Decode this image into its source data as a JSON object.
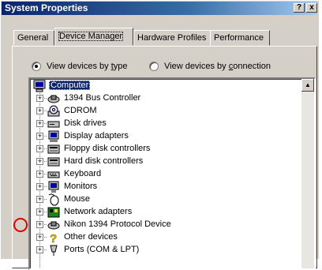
{
  "window": {
    "title": "System Properties",
    "help_label": "?",
    "close_label": "x"
  },
  "tabs": [
    {
      "label": "General"
    },
    {
      "label": "Device Manager"
    },
    {
      "label": "Hardware Profiles"
    },
    {
      "label": "Performance"
    }
  ],
  "view_options": {
    "by_type_prefix": "View devices by ",
    "by_type_accel": "t",
    "by_type_rest": "ype",
    "by_connection_prefix": "View devices by ",
    "by_connection_accel": "c",
    "by_connection_rest": "onnection",
    "selected": "by_type"
  },
  "tree": {
    "root": {
      "label": "Computer",
      "icon": "computer-icon"
    },
    "items": [
      {
        "label": "1394 Bus Controller",
        "icon": "bus-controller-icon"
      },
      {
        "label": "CDROM",
        "icon": "cdrom-icon"
      },
      {
        "label": "Disk drives",
        "icon": "disk-drive-icon"
      },
      {
        "label": "Display adapters",
        "icon": "display-adapter-icon"
      },
      {
        "label": "Floppy disk controllers",
        "icon": "floppy-controller-icon"
      },
      {
        "label": "Hard disk controllers",
        "icon": "hard-disk-controller-icon"
      },
      {
        "label": "Keyboard",
        "icon": "keyboard-icon"
      },
      {
        "label": "Monitors",
        "icon": "monitor-icon"
      },
      {
        "label": "Mouse",
        "icon": "mouse-icon"
      },
      {
        "label": "Network adapters",
        "icon": "network-adapter-icon"
      },
      {
        "label": "Nikon 1394 Protocol Device",
        "icon": "protocol-device-icon"
      },
      {
        "label": "Other devices",
        "icon": "question-mark-icon"
      },
      {
        "label": "Ports (COM & LPT)",
        "icon": "port-icon"
      }
    ],
    "expander_symbol": "+"
  },
  "colors": {
    "titlebar_start": "#0a246a",
    "selection": "#0a246a",
    "highlight_circle": "#e00000"
  }
}
